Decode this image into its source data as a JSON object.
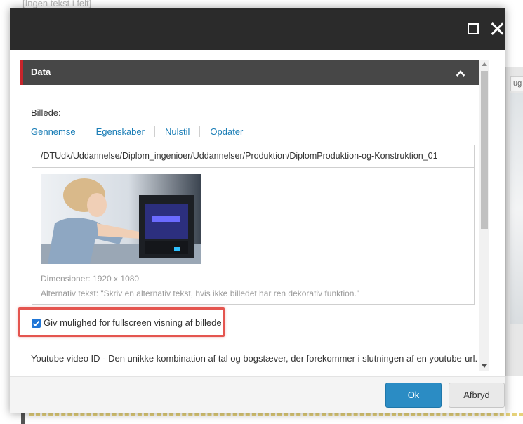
{
  "background": {
    "top_text": "[Ingen tekst i felt]"
  },
  "dialog": {
    "section": {
      "title": "Data"
    },
    "image_field": {
      "label": "Billede:",
      "links": [
        "Gennemse",
        "Egenskaber",
        "Nulstil",
        "Opdater"
      ],
      "path": "/DTUdk/Uddannelse/Diplom_ingenioer/Uddannelser/Produktion/DiplomProduktion-og-Konstruktion_01",
      "dimensions": "Dimensioner: 1920 x 1080",
      "alt_text": "Alternativ tekst: \"Skriv en alternativ tekst, hvis ikke billedet har ren dekorativ funktion.\""
    },
    "fullscreen_checkbox": {
      "label": "Giv mulighed for fullscreen visning af billede",
      "checked": true
    },
    "youtube": {
      "label": "Youtube video ID - Den unikke kombination af tal og bogstæver, der forekommer i slutningen af en youtube-url."
    },
    "footer": {
      "ok_label": "Ok",
      "cancel_label": "Afbryd"
    }
  },
  "colors": {
    "titlebar": "#2b2b2b",
    "section_header": "#474747",
    "section_accent": "#c8242b",
    "link": "#1a7db6",
    "ok_button": "#2b8cc4",
    "highlight": "#e4554f",
    "checkbox": "#2076d6"
  }
}
